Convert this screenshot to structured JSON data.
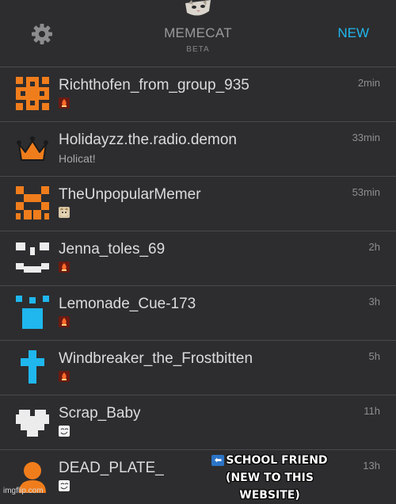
{
  "header": {
    "title": "MEMECAT",
    "subtitle": "BETA",
    "new_label": "NEW",
    "settings_icon": "gear-icon",
    "logo": "cat-logo"
  },
  "posts": [
    {
      "username": "Richthofen_from_group_935",
      "sub": "",
      "badge": "flame-badge",
      "time": "2min",
      "avatar": "orange-pixel-cross"
    },
    {
      "username": "Holidayzz.the.radio.demon",
      "sub": "Holicat!",
      "badge": "",
      "time": "33min",
      "avatar": "crown"
    },
    {
      "username": "TheUnpopularMemer",
      "sub": "",
      "badge": "cat-face-badge",
      "time": "53min",
      "avatar": "orange-checker"
    },
    {
      "username": "Jenna_toles_69",
      "sub": "",
      "badge": "flame-badge",
      "time": "2h",
      "avatar": "white-face"
    },
    {
      "username": "Lemonade_Cue-173",
      "sub": "",
      "badge": "flame-badge",
      "time": "3h",
      "avatar": "blue-block"
    },
    {
      "username": "Windbreaker_the_Frostbitten",
      "sub": "",
      "badge": "flame-badge",
      "time": "5h",
      "avatar": "blue-cross"
    },
    {
      "username": "Scrap_Baby",
      "sub": "",
      "badge": "troll-face-badge",
      "time": "11h",
      "avatar": "white-heart"
    },
    {
      "username": "DEAD_PLATE_",
      "sub": "",
      "badge": "troll-face-badge",
      "time": "13h",
      "avatar": "orange-person"
    }
  ],
  "annotation": {
    "line1": "SCHOOL FRIEND",
    "line2": "(NEW TO THIS WEBSITE)",
    "arrow_icon": "left-arrow-icon"
  },
  "watermark": "imgflip.com",
  "colors": {
    "background": "#2d2d2f",
    "accent": "#1fb7ee",
    "orange": "#f07d1c",
    "blue": "#1fb7ee",
    "divider": "#4a4a4c"
  }
}
